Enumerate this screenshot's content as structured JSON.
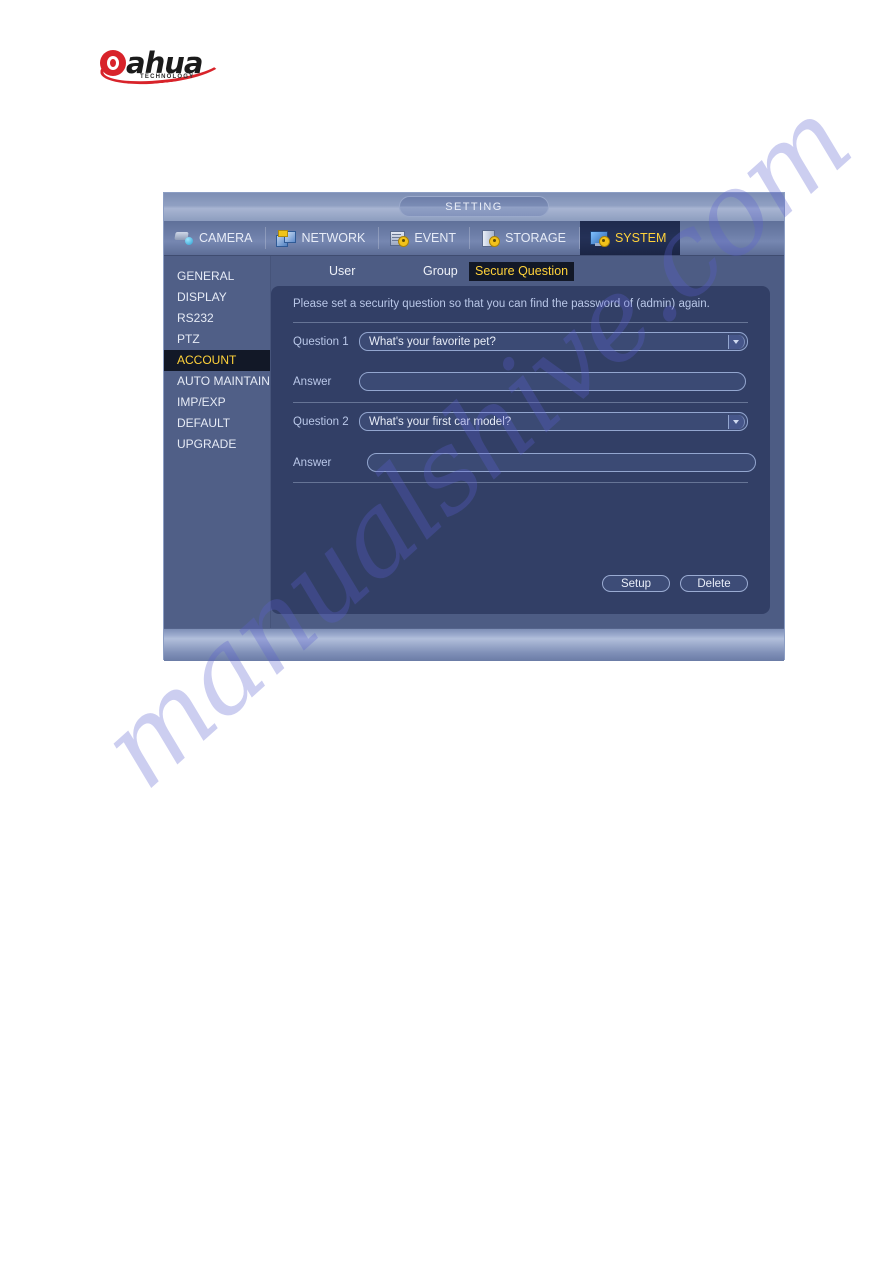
{
  "brand": {
    "logo_text": "ahua",
    "logo_sub": "TECHNOLOGY"
  },
  "watermark": {
    "text": "manualshive.com"
  },
  "window": {
    "title": "SETTING",
    "category_tabs": [
      {
        "label": "CAMERA",
        "icon": "camera-icon",
        "active": false
      },
      {
        "label": "NETWORK",
        "icon": "network-icon",
        "active": false
      },
      {
        "label": "EVENT",
        "icon": "event-icon",
        "active": false
      },
      {
        "label": "STORAGE",
        "icon": "storage-icon",
        "active": false
      },
      {
        "label": "SYSTEM",
        "icon": "system-icon",
        "active": true
      }
    ],
    "sidebar": {
      "items": [
        {
          "label": "GENERAL",
          "active": false
        },
        {
          "label": "DISPLAY",
          "active": false
        },
        {
          "label": "RS232",
          "active": false
        },
        {
          "label": "PTZ",
          "active": false
        },
        {
          "label": "ACCOUNT",
          "active": true
        },
        {
          "label": "AUTO MAINTAIN",
          "active": false
        },
        {
          "label": "IMP/EXP",
          "active": false
        },
        {
          "label": "DEFAULT",
          "active": false
        },
        {
          "label": "UPGRADE",
          "active": false
        }
      ]
    },
    "inner_tabs": [
      {
        "label": "User",
        "active": false
      },
      {
        "label": "Group",
        "active": false
      },
      {
        "label": "Secure Question",
        "active": true
      }
    ],
    "panel": {
      "notice": "Please set a security question so that you can find the password of (admin) again.",
      "question1": {
        "label": "Question 1",
        "value": "What's your favorite pet?",
        "answer_label": "Answer",
        "answer_value": "",
        "answer_placeholder": ""
      },
      "question2": {
        "label": "Question 2",
        "value": "What's your first car model?",
        "answer_label": "Answer",
        "answer_value": "",
        "answer_placeholder": ""
      },
      "buttons": {
        "setup": "Setup",
        "delete": "Delete"
      }
    }
  },
  "colors": {
    "accent_yellow": "#ffd23a",
    "panel_bg": "#323f66",
    "sidebar_bg": "#505f87",
    "active_item_bg": "#121827",
    "brand_red": "#d8232a"
  }
}
